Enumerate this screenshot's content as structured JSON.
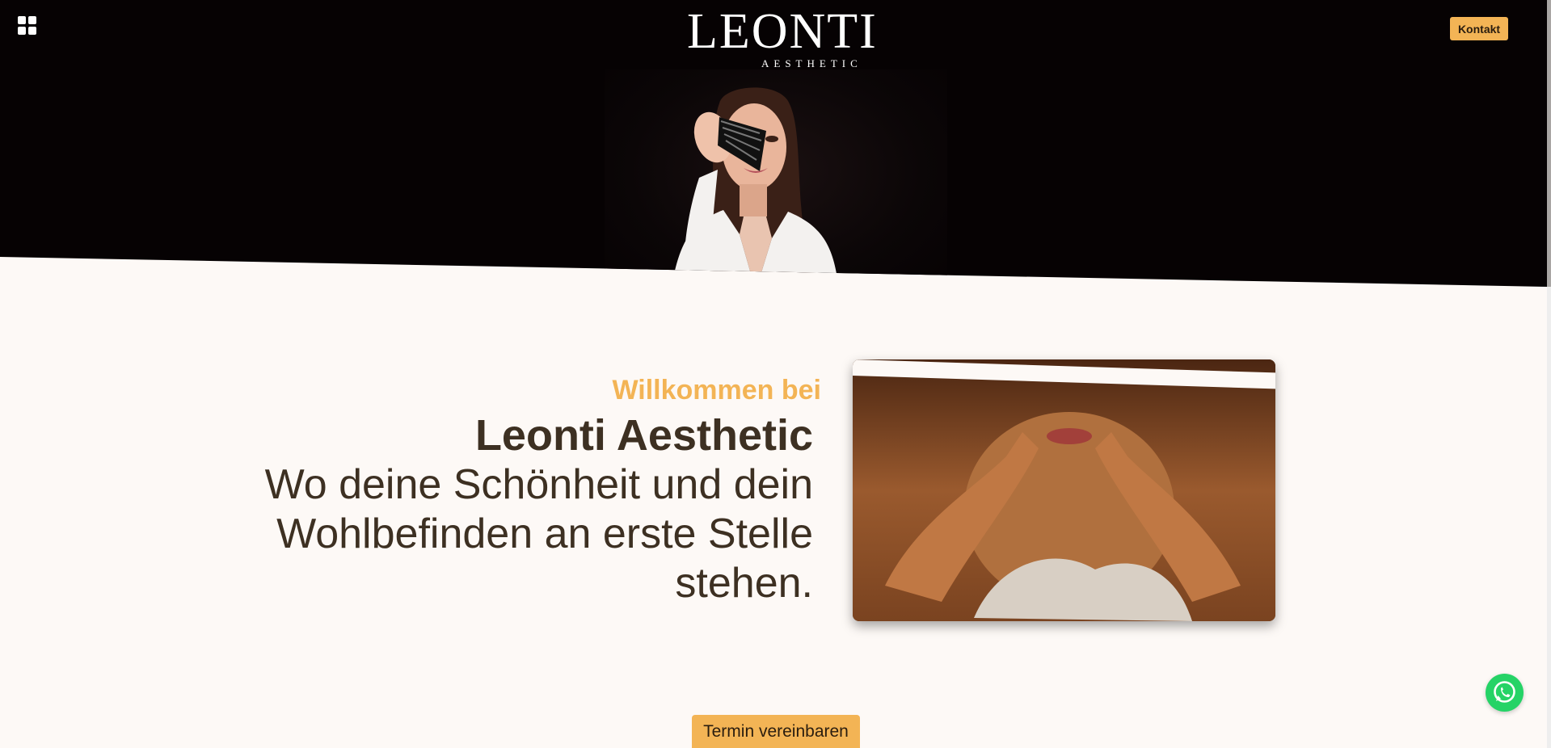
{
  "header": {
    "logo_main": "LEONTI",
    "logo_sub": "AESTHETIC",
    "contact_label": "Kontakt",
    "menu_icon": "grid-menu-icon"
  },
  "hero": {
    "image": "woman-with-brush-portrait"
  },
  "welcome": {
    "kicker": "Willkommen bei",
    "title": "Leonti Aesthetic",
    "text": "Wo deine Schönheit und dein Wohlbefinden an erste Stelle stehen."
  },
  "cta": {
    "appointment_label": "Termin vereinbaren"
  },
  "floating": {
    "whatsapp_icon": "whatsapp-icon"
  },
  "colors": {
    "accent": "#f3b455",
    "dark_bg": "#060203",
    "page_bg": "#fdf9f6",
    "text": "#3d3022",
    "whatsapp": "#25d366"
  }
}
